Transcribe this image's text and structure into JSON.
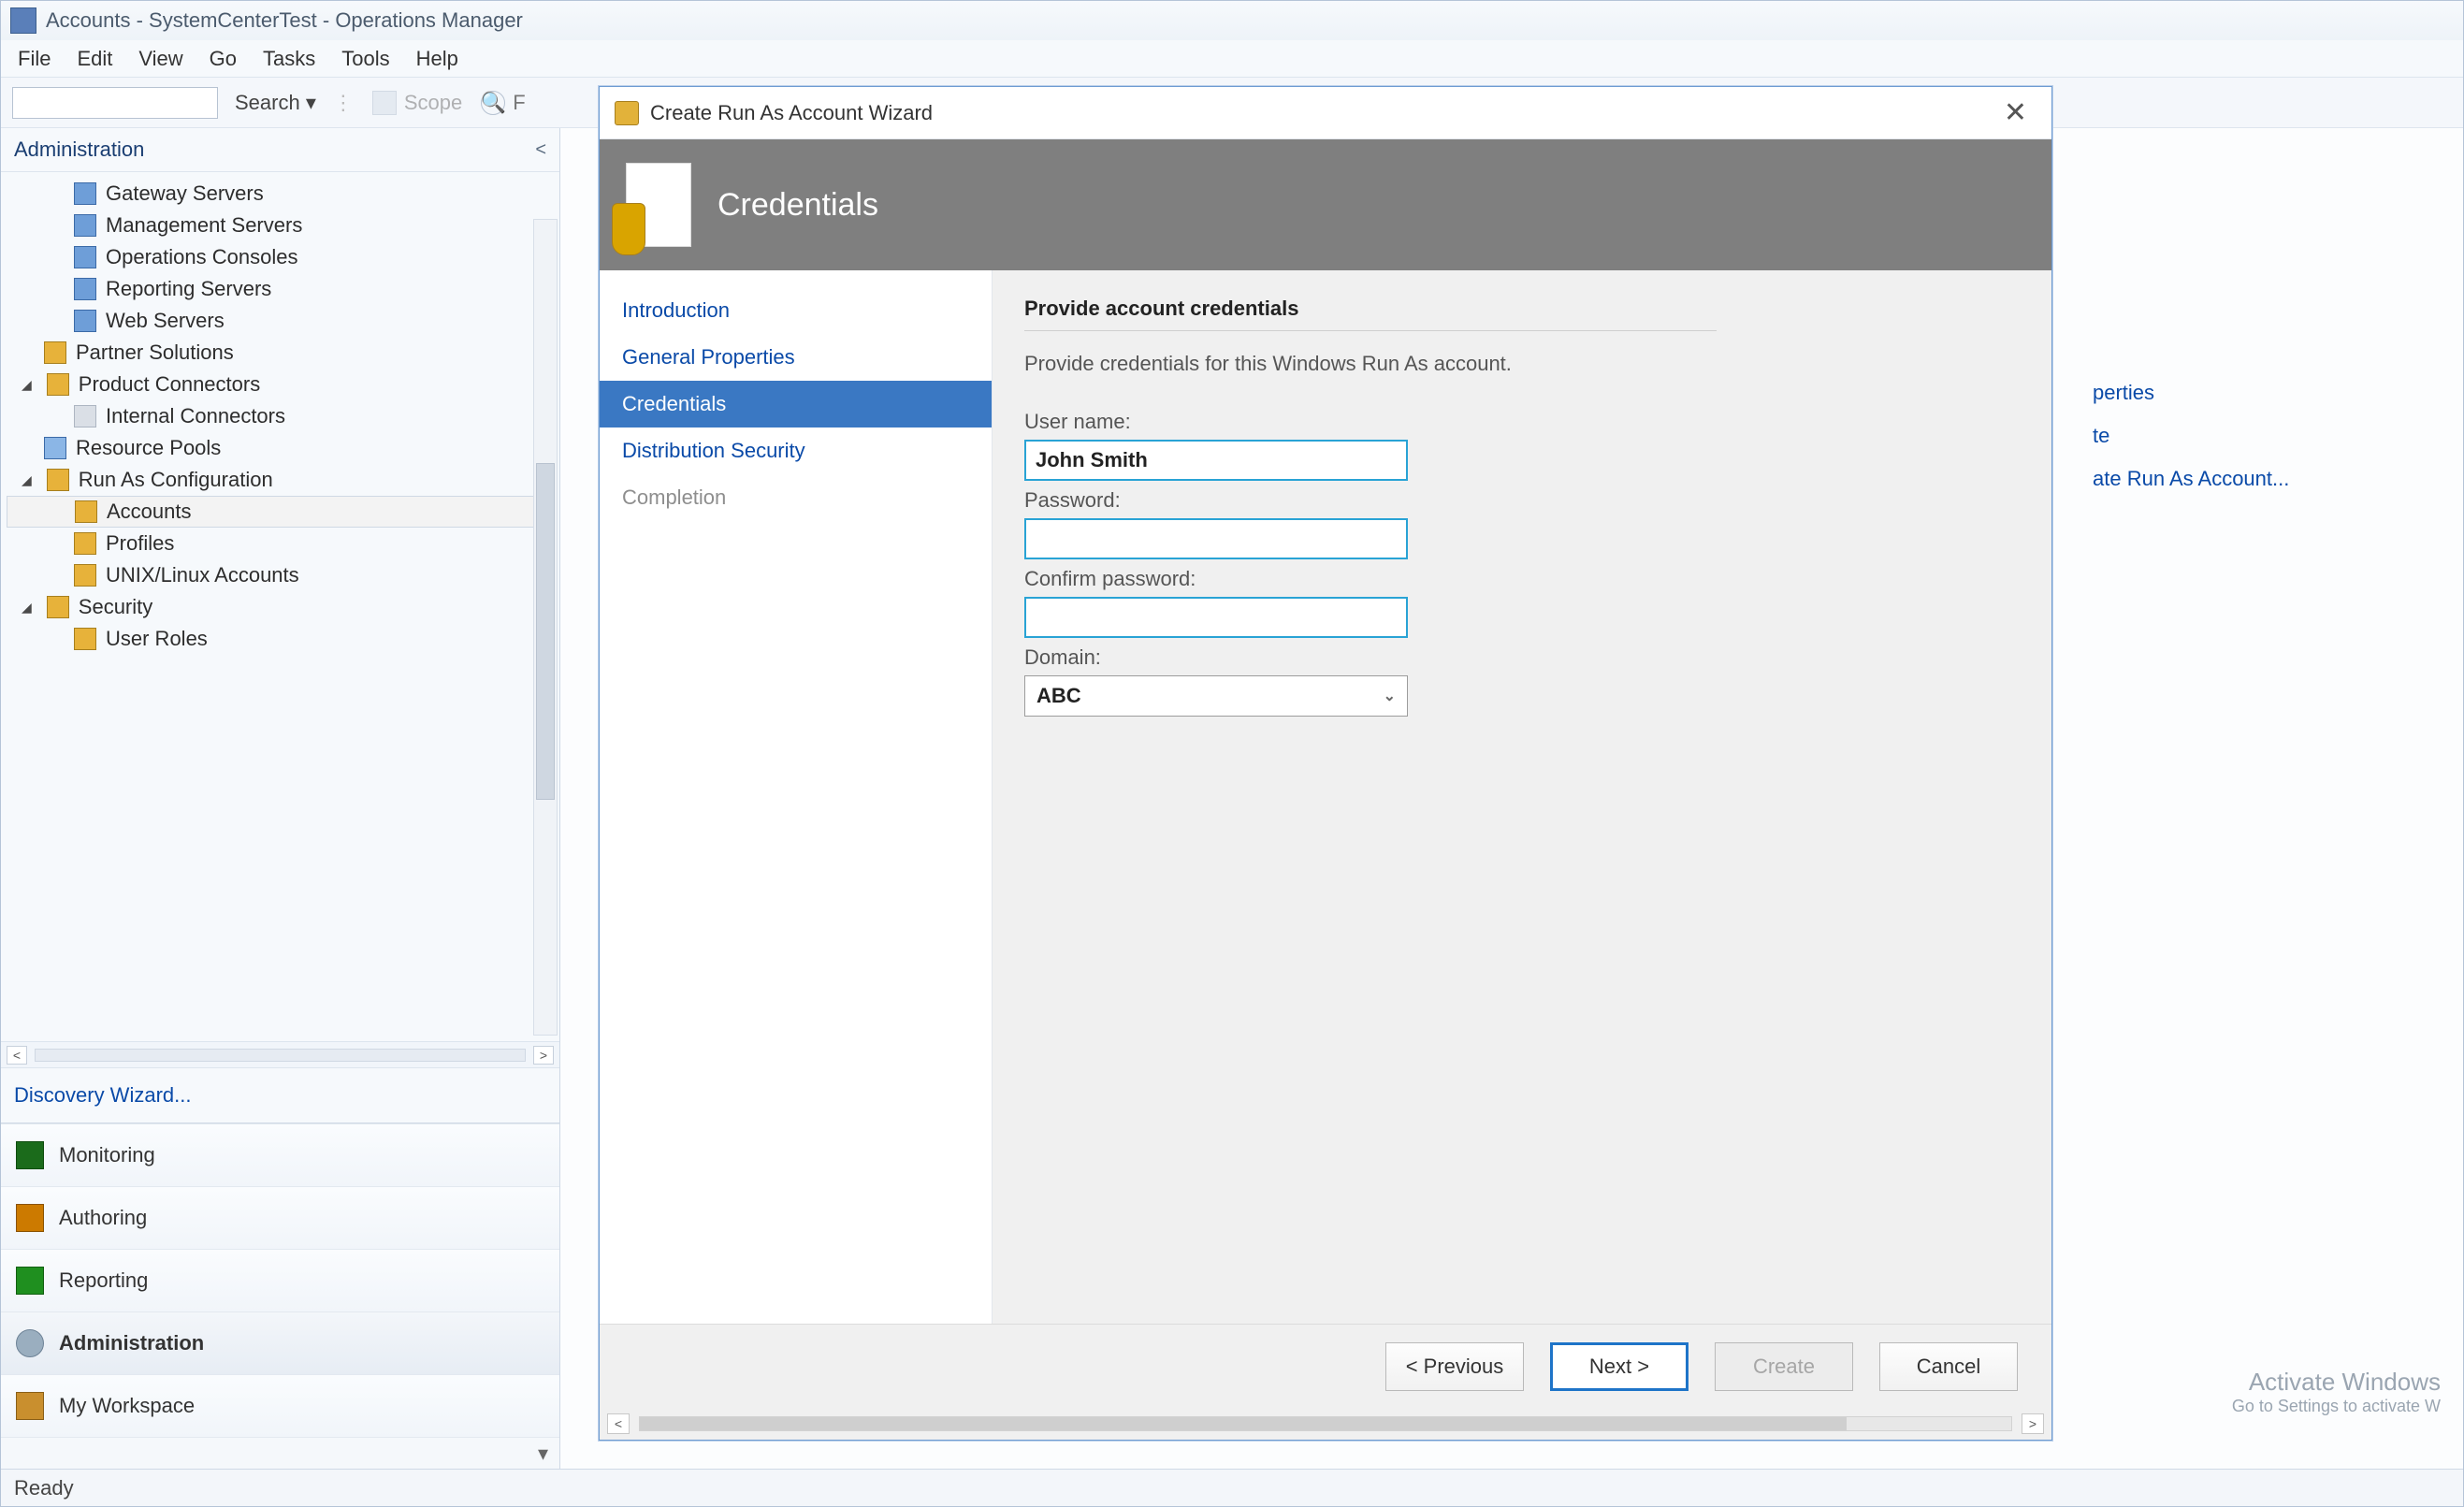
{
  "window": {
    "title": "Accounts - SystemCenterTest - Operations Manager"
  },
  "menu": {
    "file": "File",
    "edit": "Edit",
    "view": "View",
    "go": "Go",
    "tasks": "Tasks",
    "tools": "Tools",
    "help": "Help"
  },
  "toolbar": {
    "search": "Search ▾",
    "scope": "Scope",
    "find_placeholder": "F"
  },
  "nav": {
    "title": "Administration",
    "items": {
      "gateway": "Gateway Servers",
      "mgmt": "Management Servers",
      "consoles": "Operations Consoles",
      "reporting": "Reporting Servers",
      "web": "Web Servers",
      "partner": "Partner Solutions",
      "connectors": "Product Connectors",
      "internal": "Internal Connectors",
      "pools": "Resource Pools",
      "runas": "Run As Configuration",
      "accounts": "Accounts",
      "profiles": "Profiles",
      "unix": "UNIX/Linux Accounts",
      "security": "Security",
      "roles": "User Roles"
    },
    "discovery": "Discovery Wizard..."
  },
  "wunderbar": {
    "monitoring": "Monitoring",
    "authoring": "Authoring",
    "reporting": "Reporting",
    "admin": "Administration",
    "workspace": "My Workspace"
  },
  "tasks": {
    "properties": "perties",
    "delete": "te",
    "create": "ate Run As Account..."
  },
  "status": {
    "ready": "Ready"
  },
  "activate": {
    "hd": "Activate Windows",
    "sub": "Go to Settings to activate W"
  },
  "wizard": {
    "title": "Create Run As Account Wizard",
    "banner": "Credentials",
    "steps": {
      "intro": "Introduction",
      "general": "General Properties",
      "cred": "Credentials",
      "dist": "Distribution Security",
      "comp": "Completion"
    },
    "form": {
      "header": "Provide account credentials",
      "desc": "Provide credentials for this Windows Run As account.",
      "user_label": "User name:",
      "user_value": "John Smith",
      "pass_label": "Password:",
      "pass_value": "",
      "confirm_label": "Confirm password:",
      "confirm_value": "",
      "domain_label": "Domain:",
      "domain_value": "ABC"
    },
    "buttons": {
      "prev": "< Previous",
      "next": "Next >",
      "create": "Create",
      "cancel": "Cancel"
    }
  }
}
